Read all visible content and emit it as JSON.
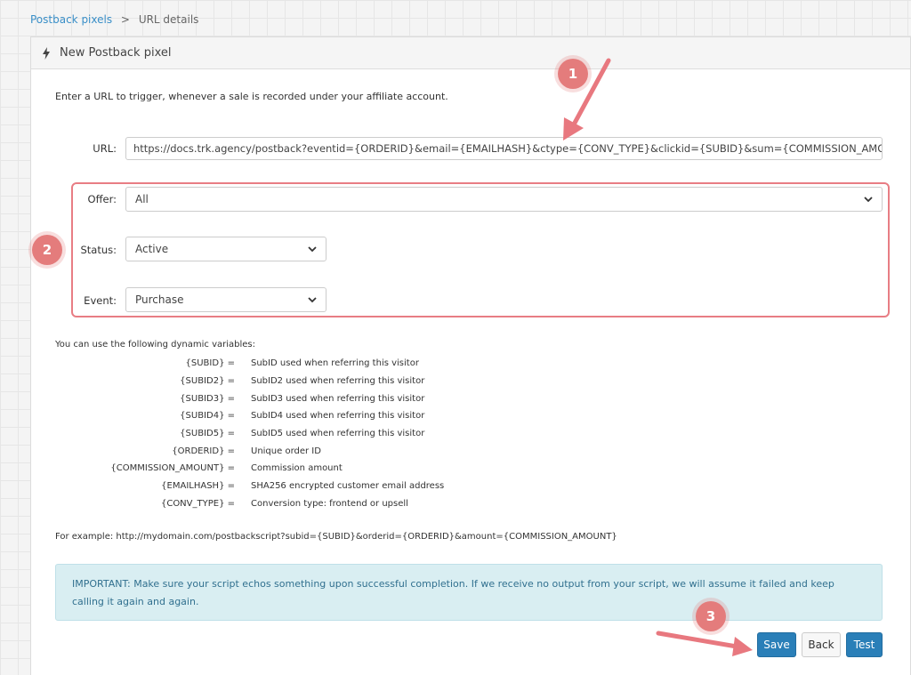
{
  "breadcrumb": {
    "parent": "Postback pixels",
    "separator": ">",
    "current": "URL details"
  },
  "panel": {
    "title": "New Postback pixel",
    "icon": "bolt-icon"
  },
  "intro": "Enter a URL to trigger, whenever a sale is recorded under your affiliate account.",
  "form": {
    "url_label": "URL:",
    "url_value": "https://docs.trk.agency/postback?eventid={ORDERID}&email={EMAILHASH}&ctype={CONV_TYPE}&clickid={SUBID}&sum={COMMISSION_AMOUN",
    "offer_label": "Offer:",
    "offer_value": "All",
    "status_label": "Status:",
    "status_value": "Active",
    "event_label": "Event:",
    "event_value": "Purchase"
  },
  "variables": {
    "intro": "You can use the following dynamic variables:",
    "rows": [
      {
        "key": "{SUBID} =",
        "desc": "SubID used when referring this visitor"
      },
      {
        "key": "{SUBID2} =",
        "desc": "SubID2 used when referring this visitor"
      },
      {
        "key": "{SUBID3} =",
        "desc": "SubID3 used when referring this visitor"
      },
      {
        "key": "{SUBID4} =",
        "desc": "SubID4 used when referring this visitor"
      },
      {
        "key": "{SUBID5} =",
        "desc": "SubID5 used when referring this visitor"
      },
      {
        "key": "{ORDERID} =",
        "desc": "Unique order ID"
      },
      {
        "key": "{COMMISSION_AMOUNT} =",
        "desc": "Commission amount"
      },
      {
        "key": "{EMAILHASH} =",
        "desc": "SHA256 encrypted customer email address"
      },
      {
        "key": "{CONV_TYPE} =",
        "desc": "Conversion type: frontend or upsell"
      }
    ]
  },
  "example": "For example: http://mydomain.com/postbackscript?subid={SUBID}&orderid={ORDERID}&amount={COMMISSION_AMOUNT}",
  "alert": "IMPORTANT: Make sure your script echos something upon successful completion. If we receive no output from your script, we will assume it failed and keep calling it again and again.",
  "buttons": {
    "save": "Save",
    "back": "Back",
    "test": "Test"
  },
  "annotations": {
    "badge1": "1",
    "badge2": "2",
    "badge3": "3"
  },
  "colors": {
    "accent": "#2a7fb8",
    "annotation": "#e47c7c",
    "alert_bg": "#d9eef2",
    "link": "#3a8fc8"
  }
}
